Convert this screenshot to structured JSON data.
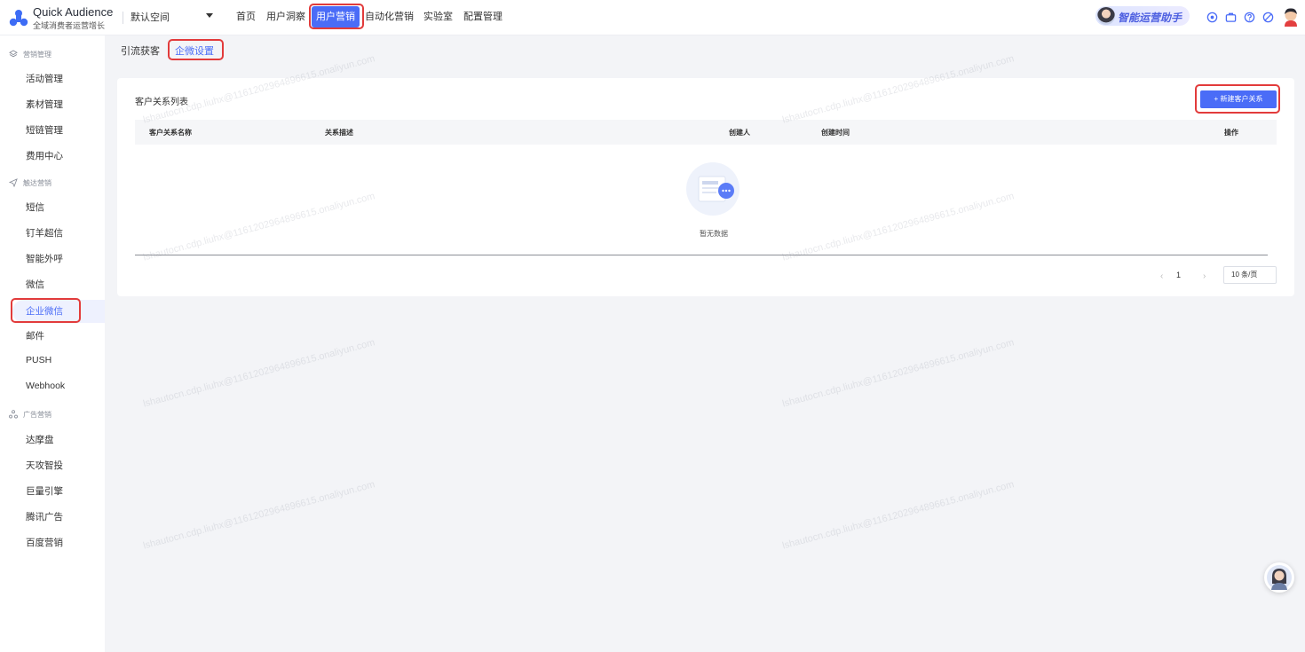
{
  "app": {
    "name": "Quick Audience",
    "subtitle": "全域消费者运营增长"
  },
  "workspace": {
    "label": "默认空间"
  },
  "top_nav": [
    {
      "label": "首页"
    },
    {
      "label": "用户洞察"
    },
    {
      "label": "用户营销",
      "active": true
    },
    {
      "label": "自动化营销"
    },
    {
      "label": "实验室"
    },
    {
      "label": "配置管理"
    }
  ],
  "assistant": {
    "label": "智能运营助手"
  },
  "toolbar_icons": [
    "help-circle-icon",
    "briefcase-icon",
    "question-icon",
    "settings-icon"
  ],
  "sidebar": {
    "groups": [
      {
        "label": "营销管理",
        "icon": "layers-icon",
        "items": [
          "活动管理",
          "素材管理",
          "短链管理",
          "费用中心"
        ]
      },
      {
        "label": "触达营销",
        "icon": "send-icon",
        "items": [
          "短信",
          "钉羊超信",
          "智能外呼",
          "微信",
          "企业微信",
          "邮件",
          "PUSH",
          "Webhook"
        ]
      },
      {
        "label": "广告营销",
        "icon": "share-icon",
        "items": [
          "达摩盘",
          "天攻智投",
          "巨量引擎",
          "腾讯广告",
          "百度营销"
        ]
      }
    ],
    "active_item": "企业微信"
  },
  "sub_tabs": [
    {
      "label": "引流获客"
    },
    {
      "label": "企微设置",
      "active": true
    }
  ],
  "card": {
    "title": "客户关系列表",
    "new_button": "+ 新建客户关系",
    "columns": [
      "客户关系名称",
      "关系描述",
      "创建人",
      "创建时间",
      "操作"
    ],
    "empty_text": "暂无数据"
  },
  "pagination": {
    "prev": "‹",
    "page": "1",
    "next": "›",
    "page_size": "10 条/页"
  },
  "watermark": "lshautocn.cdp.liuhx@1161202964896615.onaliyun.com",
  "colors": {
    "accent": "#4a6cf7",
    "highlight_box": "#e23b3b",
    "background": "#f3f4f7"
  }
}
